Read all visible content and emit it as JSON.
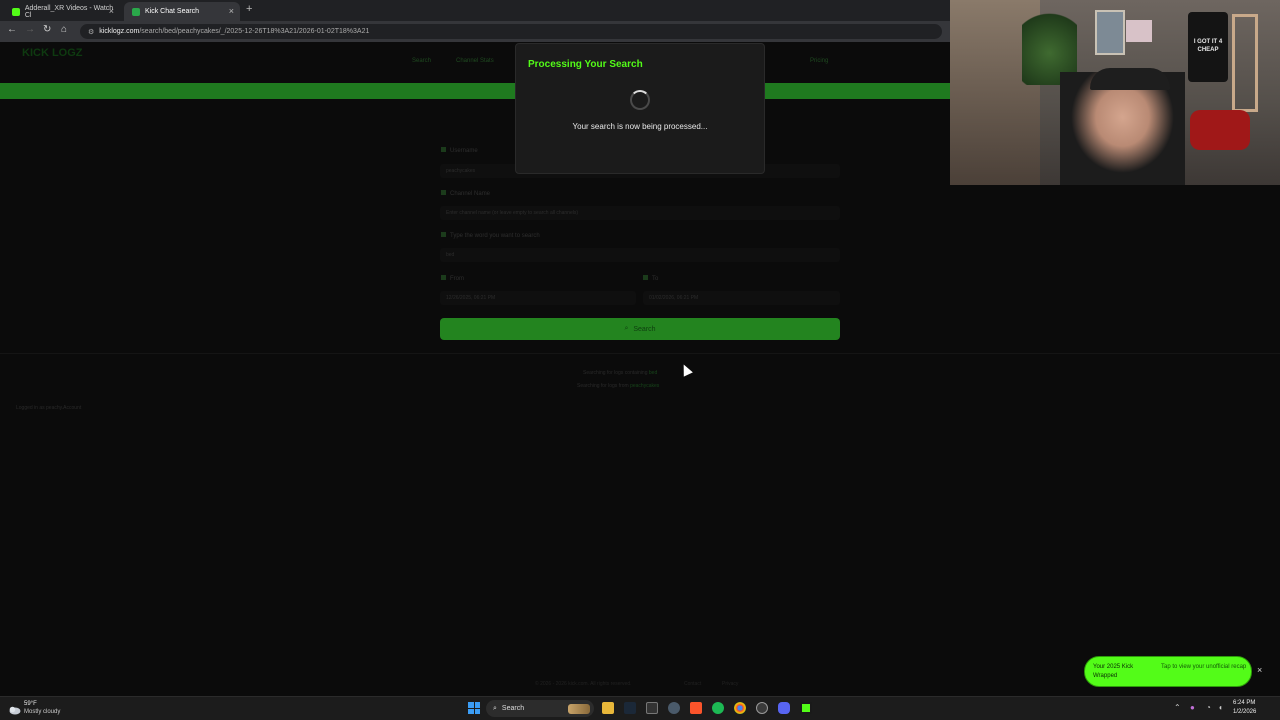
{
  "browser": {
    "tabs": [
      {
        "title": "Adderall_XR Videos - Watch Cl",
        "active": false,
        "favicon_color": "#53fc18"
      },
      {
        "title": "Kick Chat Search",
        "active": true,
        "favicon_color": "#2aa84a"
      }
    ],
    "url_host": "kicklogz.com",
    "url_path": "/search/bed/peachycakes/_/2025-12-26T18%3A21/2026-01-02T18%3A21"
  },
  "page": {
    "logo": "KICK LOGZ",
    "nav": [
      "Search",
      "Channel Stats",
      "Pricing"
    ],
    "form": {
      "username_label": "Username",
      "username_value": "peachycakes",
      "channel_label": "Channel Name",
      "channel_placeholder": "Enter channel name (or leave empty to search all channels)",
      "keyword_label": "Type the word you want to search",
      "keyword_value": "bed",
      "from_label": "From",
      "from_value": "12/26/2025, 06:21 PM",
      "to_label": "To",
      "to_value": "01/02/2026, 06:21 PM",
      "search_button": "Search"
    },
    "status_line1": "Searching for logs containing",
    "status_line1_term": "bed",
    "status_line2": "Searching for logs from",
    "status_line2_term": "peachycakes",
    "side_note": "Logged in as peachy.Account",
    "footer": "© 2026 - 2026 kick.com. All rights reserved.",
    "footer_links": [
      "Contact",
      "Privacy"
    ]
  },
  "modal": {
    "title": "Processing Your Search",
    "message": "Your search is now being processed..."
  },
  "webcam": {
    "shirt_text": "I GOT IT 4 CHEAP"
  },
  "toast": {
    "title": "Your 2025 Kick Wrapped",
    "subtitle": "Tap to view your unofficial recap",
    "close": "×"
  },
  "taskbar": {
    "weather_temp": "59°F",
    "weather_desc": "Mostly cloudy",
    "search_label": "Search",
    "time": "6:24 PM",
    "date": "1/2/2026"
  }
}
